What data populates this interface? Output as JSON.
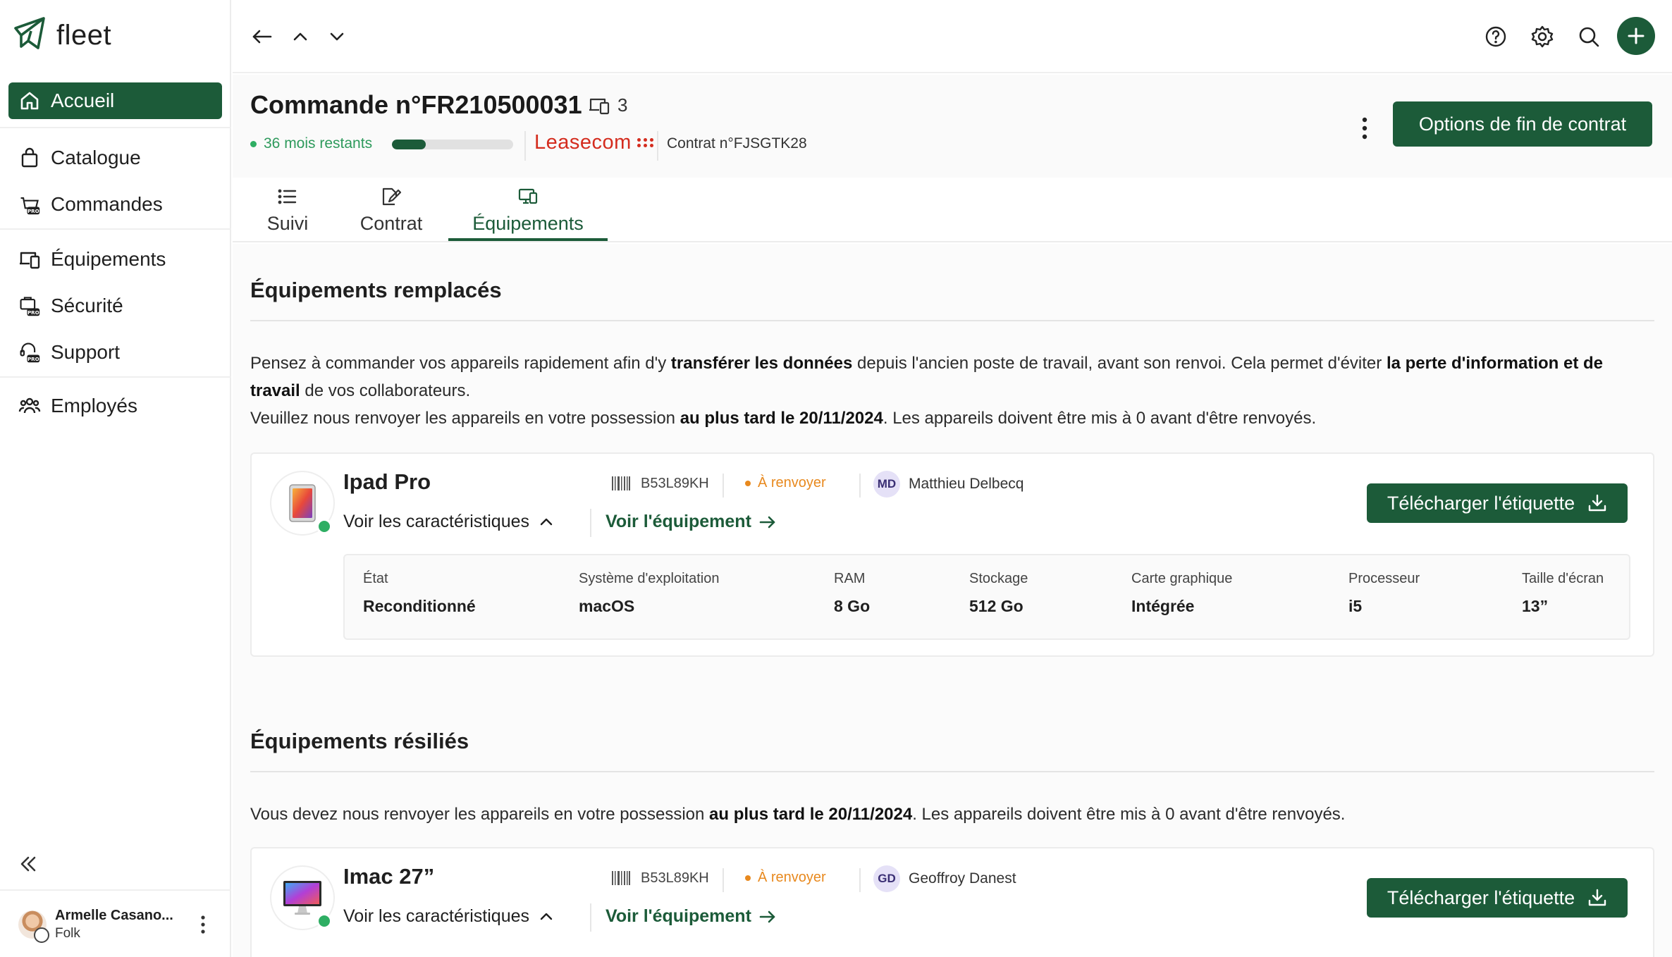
{
  "app": {
    "name": "fleet"
  },
  "sidebar": {
    "items": [
      {
        "label": "Accueil",
        "icon": "home-icon",
        "active": true
      },
      {
        "label": "Catalogue",
        "icon": "bag-icon"
      },
      {
        "label": "Commandes",
        "icon": "pro-orders-icon"
      },
      {
        "label": "Équipements",
        "icon": "devices-icon"
      },
      {
        "label": "Sécurité",
        "icon": "pro-security-icon"
      },
      {
        "label": "Support",
        "icon": "pro-support-icon"
      },
      {
        "label": "Employés",
        "icon": "people-icon"
      }
    ],
    "badge_text": "PRO",
    "user": {
      "name": "Armelle Casano...",
      "org": "Folk"
    }
  },
  "order": {
    "title": "Commande n°FR210500031",
    "device_count": "3",
    "remaining": "36 mois restants",
    "progress": 0.28,
    "lessor": "Leasecom",
    "contract": "Contrat n°FJSGTK28",
    "end_button": "Options de fin de contrat"
  },
  "tabs": [
    {
      "label": "Suivi",
      "icon": "list-icon"
    },
    {
      "label": "Contrat",
      "icon": "contract-edit-icon"
    },
    {
      "label": "Équipements",
      "icon": "devices-icon",
      "active": true
    }
  ],
  "replaced": {
    "title": "Équipements remplacés",
    "para1_a": "Pensez à commander vos appareils rapidement afin d'y ",
    "para1_b": "transférer les données",
    "para1_c": " depuis l'ancien poste de travail, avant son renvoi. Cela permet d'éviter ",
    "para1_d": "la perte d'information et de travail",
    "para1_e": " de vos collaborateurs.",
    "para2_a": "Veuillez nous renvoyer les appareils en votre possession ",
    "para2_b": "au plus tard le 20/11/2024",
    "para2_c": ". Les appareils doivent être mis à 0 avant d'être renvoyés.",
    "device": {
      "name": "Ipad Pro",
      "serial": "B53L89KH",
      "status": "À renvoyer",
      "assignee_initials": "MD",
      "assignee": "Matthieu Delbecq",
      "see_specs": "Voir les caractéristiques",
      "see_device": "Voir l'équipement",
      "download": "Télécharger l'étiquette",
      "specs": [
        {
          "label": "État",
          "value": "Reconditionné"
        },
        {
          "label": "Système d'exploitation",
          "value": "macOS"
        },
        {
          "label": "RAM",
          "value": "8 Go"
        },
        {
          "label": "Stockage",
          "value": "512 Go"
        },
        {
          "label": "Carte graphique",
          "value": "Intégrée"
        },
        {
          "label": "Processeur",
          "value": "i5"
        },
        {
          "label": "Taille d'écran",
          "value": "13”"
        }
      ]
    }
  },
  "terminated": {
    "title": "Équipements résiliés",
    "para_a": "Vous devez nous renvoyer les appareils en votre possession ",
    "para_b": "au plus tard le 20/11/2024",
    "para_c": ". Les appareils doivent être mis à 0 avant d'être renvoyés.",
    "device": {
      "name": "Imac 27”",
      "serial": "B53L89KH",
      "status": "À renvoyer",
      "assignee_initials": "GD",
      "assignee": "Geoffroy Danest",
      "see_specs": "Voir les caractéristiques",
      "see_device": "Voir l'équipement",
      "download": "Télécharger l'étiquette"
    }
  },
  "colors": {
    "brand": "#1c5b39",
    "success": "#2eae63",
    "warning": "#e8891e",
    "lessor": "#d42c1e"
  }
}
